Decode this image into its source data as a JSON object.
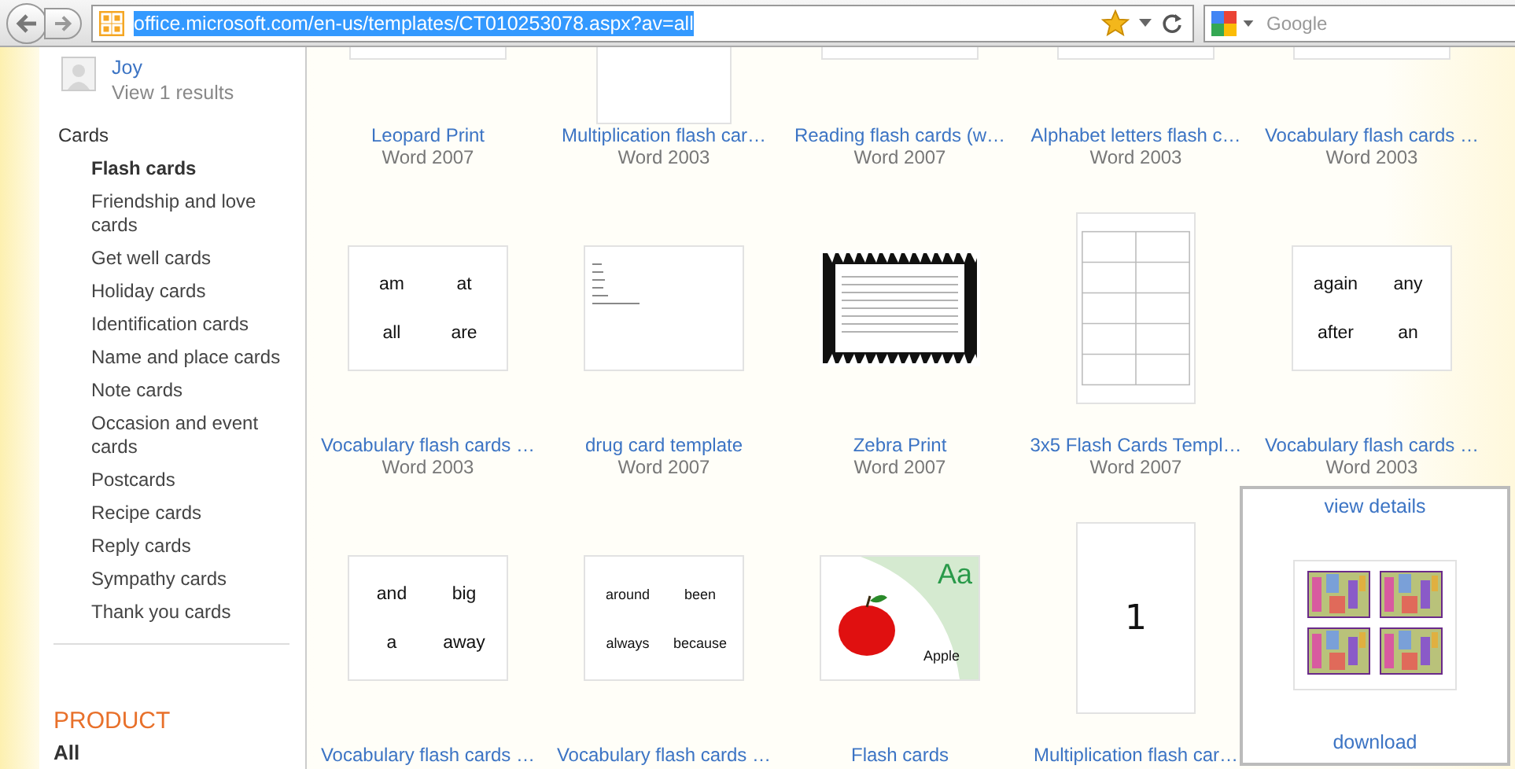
{
  "browser": {
    "url": "office.microsoft.com/en-us/templates/CT010253078.aspx?av=all",
    "search_placeholder": "Google"
  },
  "sidebar": {
    "user": {
      "name": "Joy",
      "results": "View 1 results"
    },
    "category": "Cards",
    "items": [
      {
        "label": "Flash cards",
        "selected": true
      },
      {
        "label": "Friendship and love cards",
        "selected": false
      },
      {
        "label": "Get well cards",
        "selected": false
      },
      {
        "label": "Holiday cards",
        "selected": false
      },
      {
        "label": "Identification cards",
        "selected": false
      },
      {
        "label": "Name and place cards",
        "selected": false
      },
      {
        "label": "Note cards",
        "selected": false
      },
      {
        "label": "Occasion and event cards",
        "selected": false
      },
      {
        "label": "Postcards",
        "selected": false
      },
      {
        "label": "Recipe cards",
        "selected": false
      },
      {
        "label": "Reply cards",
        "selected": false
      },
      {
        "label": "Sympathy cards",
        "selected": false
      },
      {
        "label": "Thank you cards",
        "selected": false
      }
    ],
    "product_heading": "PRODUCT",
    "product_items": [
      "All"
    ]
  },
  "templates": [
    {
      "title": "Leopard Print",
      "version": "Word 2007",
      "thumb": {
        "kind": "cut"
      }
    },
    {
      "title": "Multiplication flash car…",
      "version": "Word 2003",
      "thumb": {
        "kind": "cut_tall"
      }
    },
    {
      "title": "Reading flash cards (w…",
      "version": "Word 2007",
      "thumb": {
        "kind": "cut"
      }
    },
    {
      "title": "Alphabet letters flash c…",
      "version": "Word 2003",
      "thumb": {
        "kind": "cut"
      }
    },
    {
      "title": "Vocabulary flash cards …",
      "version": "Word 2003",
      "thumb": {
        "kind": "cut"
      }
    },
    {
      "title": "Vocabulary flash cards …",
      "version": "Word 2003",
      "thumb": {
        "kind": "words",
        "words": [
          "am",
          "at",
          "all",
          "are"
        ]
      }
    },
    {
      "title": "drug card template",
      "version": "Word 2007",
      "thumb": {
        "kind": "lines"
      }
    },
    {
      "title": "Zebra Print",
      "version": "Word 2007",
      "thumb": {
        "kind": "zebra"
      }
    },
    {
      "title": "3x5 Flash Cards Templ…",
      "version": "Word 2007",
      "thumb": {
        "kind": "grid"
      }
    },
    {
      "title": "Vocabulary flash cards …",
      "version": "Word 2003",
      "thumb": {
        "kind": "words",
        "words": [
          "again",
          "any",
          "after",
          "an"
        ]
      }
    },
    {
      "title": "Vocabulary flash cards …",
      "thumb": {
        "kind": "words",
        "words": [
          "and",
          "big",
          "a",
          "away"
        ]
      }
    },
    {
      "title": "Vocabulary flash cards …",
      "thumb": {
        "kind": "small_words",
        "words": [
          "around",
          "been",
          "always",
          "because"
        ]
      }
    },
    {
      "title": "Flash cards",
      "thumb": {
        "kind": "apple",
        "letters": "Aa",
        "word": "Apple"
      }
    },
    {
      "title": "Multiplication flash car…",
      "thumb": {
        "kind": "number",
        "number": "1"
      }
    }
  ],
  "hover_card": {
    "view_details": "view details",
    "thumb": {
      "kind": "mosaic"
    },
    "download": "download"
  }
}
